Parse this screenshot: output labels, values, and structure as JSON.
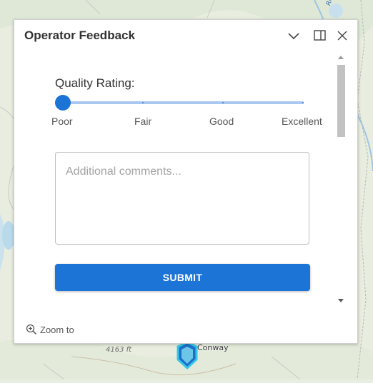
{
  "popup": {
    "title": "Operator Feedback",
    "header_icons": [
      "chevron-down-icon",
      "dock-icon",
      "close-icon"
    ]
  },
  "form": {
    "rating_label": "Quality Rating:",
    "rating_options": [
      "Poor",
      "Fair",
      "Good",
      "Excellent"
    ],
    "selected_rating": "Poor",
    "comments_placeholder": "Additional comments...",
    "comments_value": "",
    "submit_label": "SUBMIT"
  },
  "footer": {
    "zoom_to_label": "Zoom to",
    "zoom_icon": "zoom-in-icon"
  },
  "map": {
    "elevation_label": "4163 ft",
    "town_label": "Conway",
    "marker_icon": "location-marker-icon"
  },
  "colors": {
    "accent": "#1b74d6",
    "track": "#a9c7ef",
    "marker": "#35c6e8"
  }
}
